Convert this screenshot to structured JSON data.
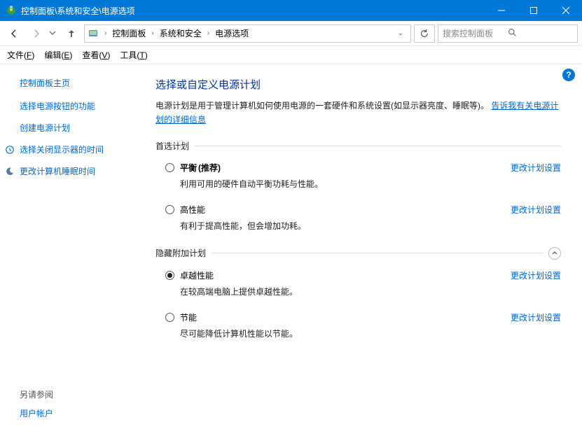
{
  "window": {
    "title": "控制面板\\系统和安全\\电源选项"
  },
  "breadcrumbs": {
    "root": "控制面板",
    "mid": "系统和安全",
    "leaf": "电源选项"
  },
  "search": {
    "placeholder": "搜索控制面板"
  },
  "menu": {
    "file": "文件(",
    "file_u": "F",
    "file_close": ")",
    "edit": "编辑(",
    "edit_u": "E",
    "edit_close": ")",
    "view": "查看(",
    "view_u": "V",
    "view_close": ")",
    "tools": "工具(",
    "tools_u": "T",
    "tools_close": ")"
  },
  "sidebar": {
    "home": "控制面板主页",
    "links": [
      {
        "label": "选择电源按钮的功能"
      },
      {
        "label": "创建电源计划"
      },
      {
        "label": "选择关闭显示器的时间",
        "icon": "clock"
      },
      {
        "label": "更改计算机睡眠时间",
        "icon": "moon"
      }
    ],
    "see_also": "另请参阅",
    "user_accounts": "用户帐户"
  },
  "main": {
    "heading": "选择或自定义电源计划",
    "intro_pre": "电源计划是用于管理计算机如何使用电源的一套硬件和系统设置(如显示器亮度、睡眠等)。",
    "intro_link": "告诉我有关电源计划的详细信息",
    "group1": "首选计划",
    "group2": "隐藏附加计划",
    "change_link": "更改计划设置",
    "recommended": "(推荐)",
    "plans1": [
      {
        "name": "平衡",
        "desc": "利用可用的硬件自动平衡功耗与性能。",
        "selected": false,
        "bold": true,
        "rec": true
      },
      {
        "name": "高性能",
        "desc": "有利于提高性能，但会增加功耗。",
        "selected": false
      }
    ],
    "plans2": [
      {
        "name": "卓越性能",
        "desc": "在较高端电脑上提供卓越性能。",
        "selected": true
      },
      {
        "name": "节能",
        "desc": "尽可能降低计算机性能以节能。",
        "selected": false
      }
    ]
  }
}
